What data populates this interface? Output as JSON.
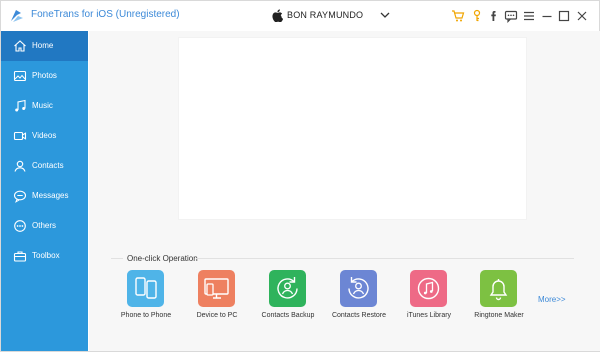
{
  "app": {
    "title": "FoneTrans for iOS (Unregistered)"
  },
  "device": {
    "name": "BON RAYMUNDO"
  },
  "toolbar": [
    {
      "name": "cart-icon",
      "color": "#f0a500"
    },
    {
      "name": "key-icon",
      "color": "#f0a500"
    },
    {
      "name": "facebook-icon",
      "color": "#444444"
    },
    {
      "name": "chat-icon",
      "color": "#444444"
    },
    {
      "name": "menu-icon",
      "color": "#444444"
    },
    {
      "name": "minimize-icon",
      "color": "#444444"
    },
    {
      "name": "maximize-icon",
      "color": "#444444"
    },
    {
      "name": "close-icon",
      "color": "#444444"
    }
  ],
  "sidebar": {
    "items": [
      {
        "label": "Home",
        "icon": "home-icon",
        "active": true
      },
      {
        "label": "Photos",
        "icon": "photo-icon",
        "active": false
      },
      {
        "label": "Music",
        "icon": "music-icon",
        "active": false
      },
      {
        "label": "Videos",
        "icon": "video-icon",
        "active": false
      },
      {
        "label": "Contacts",
        "icon": "contacts-icon",
        "active": false
      },
      {
        "label": "Messages",
        "icon": "messages-icon",
        "active": false
      },
      {
        "label": "Others",
        "icon": "others-icon",
        "active": false
      },
      {
        "label": "Toolbox",
        "icon": "toolbox-icon",
        "active": false
      }
    ]
  },
  "oneclick": {
    "title": "One-click Operation",
    "more": "More>>",
    "operations": [
      {
        "label": "Phone to Phone",
        "color": "#4fb4e8",
        "icon": "phone-to-phone-icon"
      },
      {
        "label": "Device to PC",
        "color": "#ee8060",
        "icon": "device-to-pc-icon"
      },
      {
        "label": "Contacts Backup",
        "color": "#2fb35c",
        "icon": "contacts-backup-icon"
      },
      {
        "label": "Contacts Restore",
        "color": "#6c86d4",
        "icon": "contacts-restore-icon"
      },
      {
        "label": "iTunes Library",
        "color": "#ee6a86",
        "icon": "itunes-library-icon"
      },
      {
        "label": "Ringtone Maker",
        "color": "#7dc142",
        "icon": "ringtone-maker-icon"
      }
    ]
  },
  "colors": {
    "sidebar": "#2c98dc",
    "sidebar_active": "#2178c2",
    "accent": "#3d8ad8"
  }
}
